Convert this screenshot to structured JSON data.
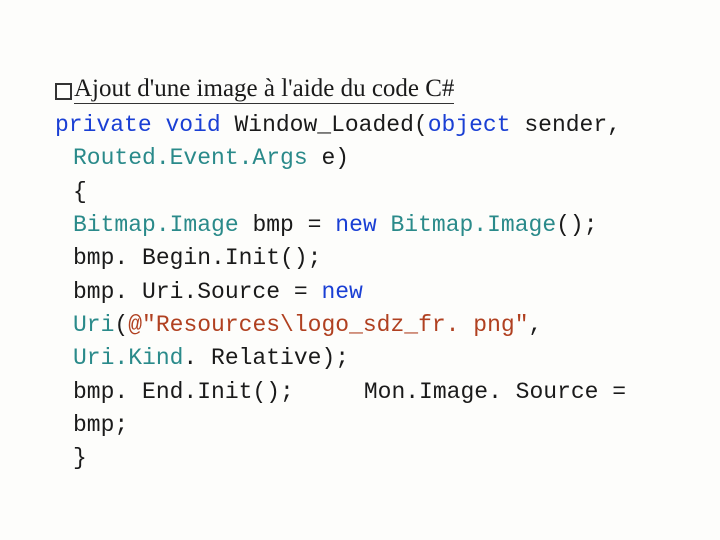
{
  "heading": {
    "text": "Ajout d'une image à l'aide du code C#"
  },
  "code": {
    "l1_kw1": "private",
    "l1_kw2": "void",
    "l1_method": " Window_Loaded(",
    "l1_kw3": "object",
    "l1_rest": " sender, ",
    "l2_type": "Routed.Event.Args",
    "l2_rest": " e)",
    "l3": "{",
    "l4_type1": "Bitmap.Image",
    "l4_mid": " bmp = ",
    "l4_kw": "new",
    "l4_type2": " Bitmap.Image",
    "l4_end": "();",
    "l5": "bmp. Begin.Init();",
    "l6_a": "bmp. Uri.Source = ",
    "l6_kw": "new",
    "l7_type": "Uri",
    "l7_a": "(",
    "l7_str": "@\"Resources\\logo_sdz_fr. png\"",
    "l7_b": ", ",
    "l7_type2": "Uri.Kind",
    "l7_c": ". Relative);",
    "l8_a": "bmp. End.Init();",
    "l8_b": "Mon.Image. Source = bmp;",
    "l9": "}"
  }
}
